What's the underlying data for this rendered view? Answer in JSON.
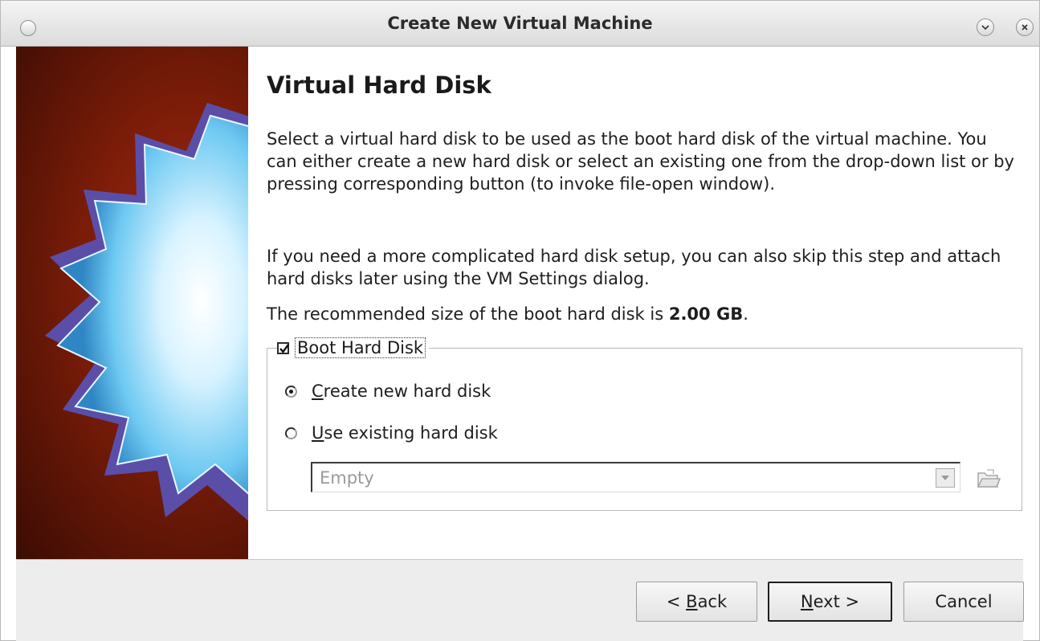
{
  "window": {
    "title": "Create New Virtual Machine"
  },
  "page": {
    "heading": "Virtual Hard Disk",
    "paragraph1": "Select a virtual hard disk to be used as the boot hard disk of the virtual machine. You can either create a new hard disk or select an existing one from the drop-down list or by pressing corresponding button (to invoke file-open window).",
    "paragraph2": "If you need a more complicated hard disk setup, you can also skip this step and attach hard disks later using the VM Settings dialog.",
    "recommended_prefix": "The recommended size of the boot hard disk is ",
    "recommended_size": "2.00 GB",
    "recommended_suffix": "."
  },
  "boot_disk_group": {
    "checkbox_label": "Boot Hard Disk",
    "checked": true,
    "options": [
      {
        "mnemonic": "C",
        "rest": "reate new hard disk",
        "selected": true
      },
      {
        "mnemonic": "U",
        "rest": "se existing hard disk",
        "selected": false
      }
    ],
    "combo_value": "Empty"
  },
  "buttons": {
    "back_prefix": "< ",
    "back_mnemonic": "B",
    "back_rest": "ack",
    "next_mnemonic": "N",
    "next_rest": "ext >",
    "cancel": "Cancel"
  },
  "icons": {
    "window_menu": "window-menu-icon",
    "minimize": "chevron-down-icon",
    "close": "close-icon",
    "check": "check-icon",
    "dropdown": "dropdown-arrow-icon",
    "browse": "folder-open-icon"
  }
}
